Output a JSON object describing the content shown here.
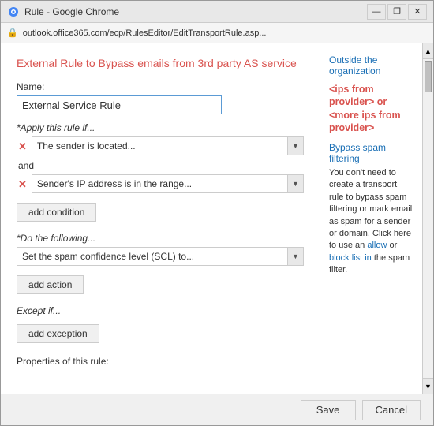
{
  "window": {
    "title": "Rule - Google Chrome",
    "address": "outlook.office365.com/ecp/RulesEditor/EditTransportRule.asp..."
  },
  "page": {
    "title": "External Rule to Bypass emails from 3rd party AS service",
    "name_label": "Name:",
    "name_value": "External Service Rule",
    "apply_label": "*Apply this rule if...",
    "condition1": "The sender is located...",
    "and_label": "and",
    "condition2": "Sender's IP address is in the range...",
    "add_condition_label": "add condition",
    "do_label": "*Do the following...",
    "action1": "Set the spam confidence level (SCL) to...",
    "add_action_label": "add action",
    "except_label": "Except if...",
    "add_exception_label": "add exception",
    "properties_label": "Properties of this rule:"
  },
  "right_panel": {
    "outside_org_link": "Outside the organization",
    "ips_text": "<ips from provider> or <more ips from provider>",
    "bypass_title": "Bypass spam filtering",
    "bypass_desc": "You don't need to create a transport rule to bypass spam filtering or mark email as spam for a sender or domain. Click here to use an",
    "allow_link": "allow",
    "or_text": "or",
    "block_link": "block list in",
    "spam_filter_text": "the spam filter."
  },
  "buttons": {
    "save": "Save",
    "cancel": "Cancel"
  },
  "title_bar_buttons": {
    "minimize": "—",
    "restore": "❐",
    "close": "✕"
  }
}
